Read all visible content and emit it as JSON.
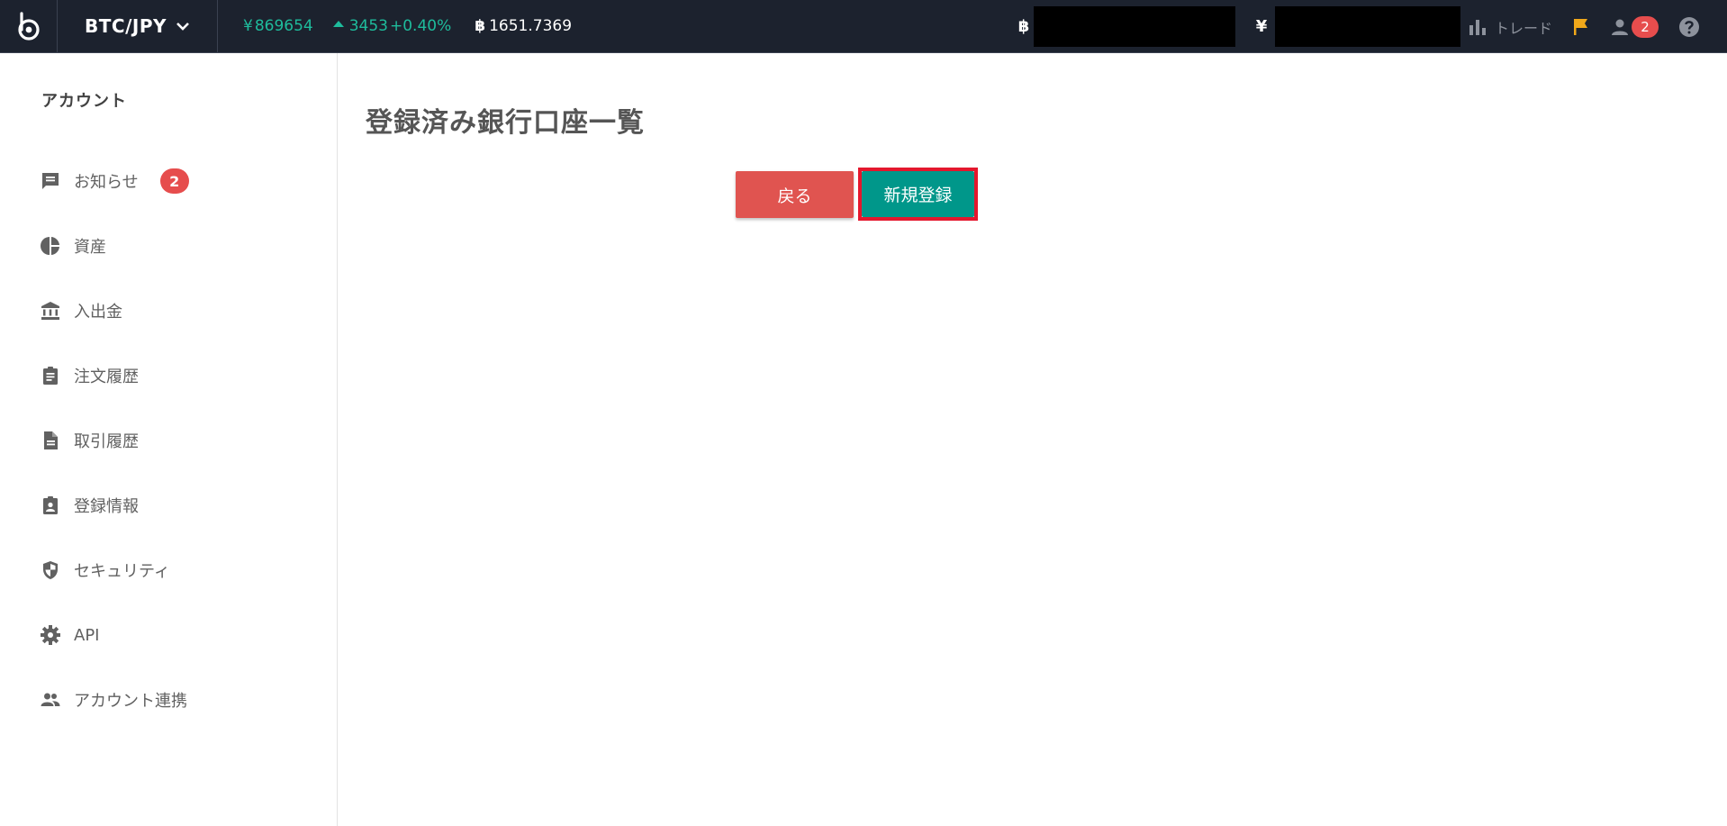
{
  "header": {
    "pair": "BTC/JPY",
    "price_symbol": "¥",
    "price": "869654",
    "change_abs": "3453",
    "change_pct": "+0.40%",
    "volume_symbol": "฿",
    "volume": "1651.7369",
    "balance_btc_symbol": "฿",
    "balance_jpy_symbol": "¥",
    "trade_label": "トレード",
    "notification_count": "2"
  },
  "sidebar": {
    "title": "アカウント",
    "items": [
      {
        "label": "お知らせ",
        "icon": "message-icon",
        "badge": "2"
      },
      {
        "label": "資産",
        "icon": "pie-chart-icon"
      },
      {
        "label": "入出金",
        "icon": "bank-icon"
      },
      {
        "label": "注文履歴",
        "icon": "clipboard-icon"
      },
      {
        "label": "取引履歴",
        "icon": "document-icon"
      },
      {
        "label": "登録情報",
        "icon": "id-badge-icon"
      },
      {
        "label": "セキュリティ",
        "icon": "shield-icon"
      },
      {
        "label": "API",
        "icon": "gear-icon"
      },
      {
        "label": "アカウント連携",
        "icon": "people-icon"
      }
    ]
  },
  "main": {
    "title": "登録済み銀行口座一覧",
    "back_label": "戻る",
    "new_label": "新規登録"
  },
  "colors": {
    "topbar": "#1c222e",
    "green": "#1ebc9c",
    "badge_red": "#e64d4d",
    "back_button": "#e05450",
    "new_button": "#00978a",
    "highlight": "#e4172d"
  }
}
